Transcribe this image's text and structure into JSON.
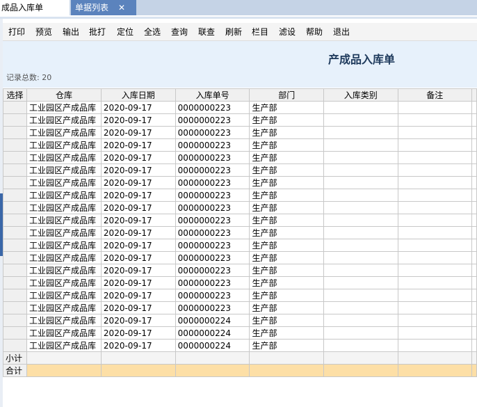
{
  "tabs": {
    "active": "成品入库单",
    "inactive": "单据列表",
    "close": "✕"
  },
  "toolbar": [
    "打印",
    "预览",
    "输出",
    "批打",
    "定位",
    "全选",
    "查询",
    "联查",
    "刷新",
    "栏目",
    "滤设",
    "帮助",
    "退出"
  ],
  "report": {
    "title": "产成品入库单",
    "record_label": "记录总数:",
    "record_count": "20"
  },
  "table": {
    "columns": [
      "选择",
      "仓库",
      "入库日期",
      "入库单号",
      "部门",
      "入库类别",
      "备注"
    ],
    "rows": [
      [
        "",
        "工业园区产成品库",
        "2020-09-17",
        "0000000223",
        "生产部",
        "",
        ""
      ],
      [
        "",
        "工业园区产成品库",
        "2020-09-17",
        "0000000223",
        "生产部",
        "",
        ""
      ],
      [
        "",
        "工业园区产成品库",
        "2020-09-17",
        "0000000223",
        "生产部",
        "",
        ""
      ],
      [
        "",
        "工业园区产成品库",
        "2020-09-17",
        "0000000223",
        "生产部",
        "",
        ""
      ],
      [
        "",
        "工业园区产成品库",
        "2020-09-17",
        "0000000223",
        "生产部",
        "",
        ""
      ],
      [
        "",
        "工业园区产成品库",
        "2020-09-17",
        "0000000223",
        "生产部",
        "",
        ""
      ],
      [
        "",
        "工业园区产成品库",
        "2020-09-17",
        "0000000223",
        "生产部",
        "",
        ""
      ],
      [
        "",
        "工业园区产成品库",
        "2020-09-17",
        "0000000223",
        "生产部",
        "",
        ""
      ],
      [
        "",
        "工业园区产成品库",
        "2020-09-17",
        "0000000223",
        "生产部",
        "",
        ""
      ],
      [
        "",
        "工业园区产成品库",
        "2020-09-17",
        "0000000223",
        "生产部",
        "",
        ""
      ],
      [
        "",
        "工业园区产成品库",
        "2020-09-17",
        "0000000223",
        "生产部",
        "",
        ""
      ],
      [
        "",
        "工业园区产成品库",
        "2020-09-17",
        "0000000223",
        "生产部",
        "",
        ""
      ],
      [
        "",
        "工业园区产成品库",
        "2020-09-17",
        "0000000223",
        "生产部",
        "",
        ""
      ],
      [
        "",
        "工业园区产成品库",
        "2020-09-17",
        "0000000223",
        "生产部",
        "",
        ""
      ],
      [
        "",
        "工业园区产成品库",
        "2020-09-17",
        "0000000223",
        "生产部",
        "",
        ""
      ],
      [
        "",
        "工业园区产成品库",
        "2020-09-17",
        "0000000223",
        "生产部",
        "",
        ""
      ],
      [
        "",
        "工业园区产成品库",
        "2020-09-17",
        "0000000223",
        "生产部",
        "",
        ""
      ],
      [
        "",
        "工业园区产成品库",
        "2020-09-17",
        "0000000224",
        "生产部",
        "",
        ""
      ],
      [
        "",
        "工业园区产成品库",
        "2020-09-17",
        "0000000224",
        "生产部",
        "",
        ""
      ],
      [
        "",
        "工业园区产成品库",
        "2020-09-17",
        "0000000224",
        "生产部",
        "",
        ""
      ]
    ],
    "subtotal_label": "小计",
    "total_label": "合计"
  }
}
